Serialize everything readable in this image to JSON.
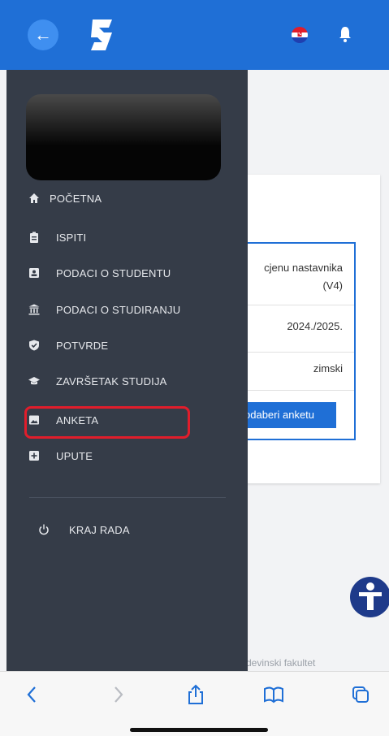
{
  "header": {
    "back_icon": "arrow-left-icon",
    "logo_icon": "app-logo-icon",
    "language_icon": "croatia-flag-icon",
    "notification_icon": "bell-icon"
  },
  "background_card": {
    "rows": [
      {
        "line1": "cjenu nastavnika",
        "line2": "(V4)"
      },
      {
        "line1": "2024./2025.",
        "line2": ""
      },
      {
        "line1": "zimski",
        "line2": ""
      }
    ],
    "button_label": "dabери anketu",
    "footer_text": "devinski fakultet"
  },
  "sidebar": {
    "items": [
      {
        "label": "POČETNA",
        "icon": "home-icon"
      },
      {
        "label": "ISPITI",
        "icon": "clipboard-icon"
      },
      {
        "label": "PODACI O STUDENTU",
        "icon": "id-card-icon"
      },
      {
        "label": "PODACI O STUDIRANJU",
        "icon": "university-icon"
      },
      {
        "label": "POTVRDE",
        "icon": "shield-check-icon"
      },
      {
        "label": "ZAVRŠETAK STUDIJA",
        "icon": "graduation-cap-icon"
      },
      {
        "label": "ANKETA",
        "icon": "image-icon"
      },
      {
        "label": "UPUTE",
        "icon": "plus-square-icon"
      }
    ],
    "logout_label": "KRAJ RADA",
    "logout_icon": "power-icon"
  },
  "colors": {
    "header_blue": "#1f6fd6",
    "sidebar_bg": "#353c48",
    "highlight_red": "#e11d2b"
  }
}
